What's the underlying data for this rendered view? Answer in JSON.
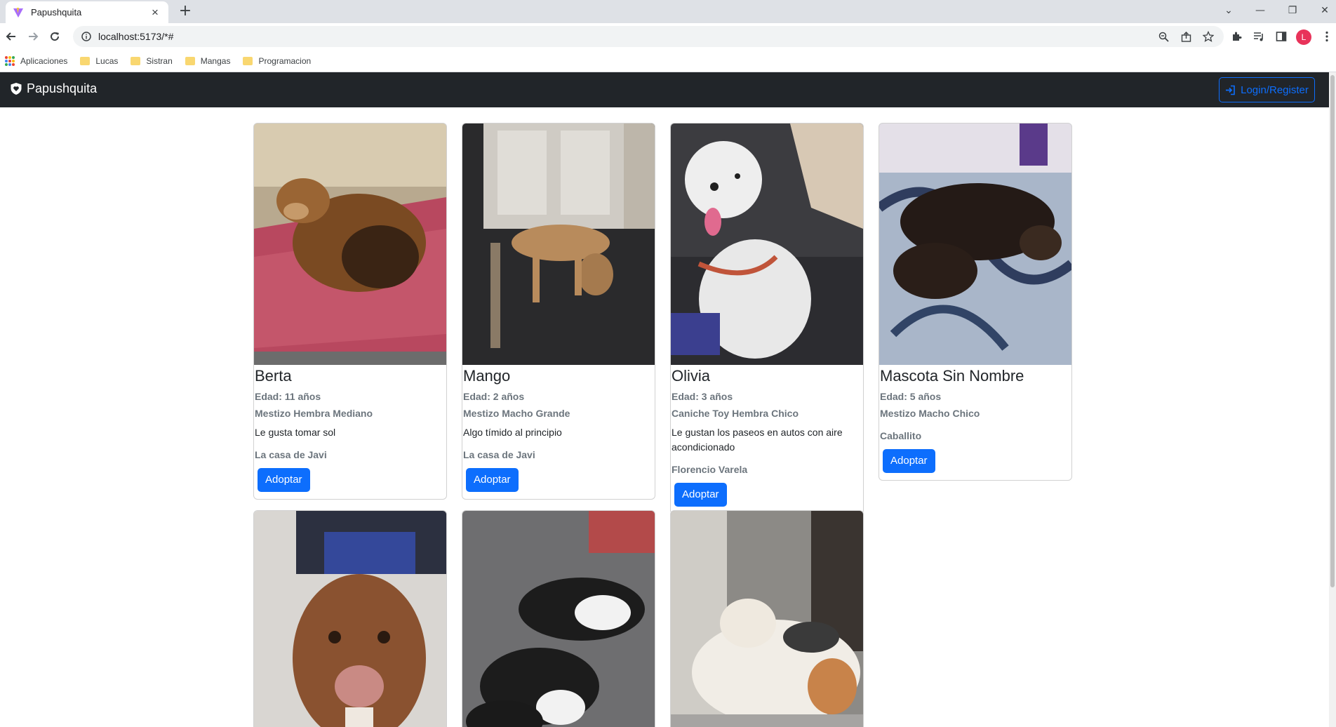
{
  "browser": {
    "tab_title": "Papushquita",
    "url": "localhost:5173/*#",
    "bookmarks": [
      {
        "label": "Aplicaciones",
        "icon": "apps-grid-icon"
      },
      {
        "label": "Lucas",
        "icon": "folder-icon"
      },
      {
        "label": "Sistran",
        "icon": "folder-icon"
      },
      {
        "label": "Mangas",
        "icon": "folder-icon"
      },
      {
        "label": "Programacion",
        "icon": "folder-icon"
      }
    ],
    "profile_initial": "L"
  },
  "navbar": {
    "brand": "Papushquita",
    "login_label": "Login/Register"
  },
  "pets": [
    {
      "name": "Berta",
      "age": "Edad: 11 años",
      "desc": "Mestizo Hembra Mediano",
      "note": "Le gusta tomar sol",
      "place": "La casa de Javi",
      "button": "Adoptar"
    },
    {
      "name": "Mango",
      "age": "Edad: 2 años",
      "desc": "Mestizo Macho Grande",
      "note": "Algo tímido al principio",
      "place": "La casa de Javi",
      "button": "Adoptar"
    },
    {
      "name": "Olivia",
      "age": "Edad: 3 años",
      "desc": "Caniche Toy Hembra Chico",
      "note": "Le gustan los paseos en autos con aire acondicionado",
      "place": "Florencio Varela",
      "button": "Adoptar"
    },
    {
      "name": "Mascota Sin Nombre",
      "age": "Edad: 5 años",
      "desc": "Mestizo Macho Chico",
      "note": "",
      "place": "Caballito",
      "button": "Adoptar"
    }
  ],
  "colors": {
    "navbar_bg": "#212529",
    "primary": "#0d6efd",
    "muted": "#6c757d"
  }
}
